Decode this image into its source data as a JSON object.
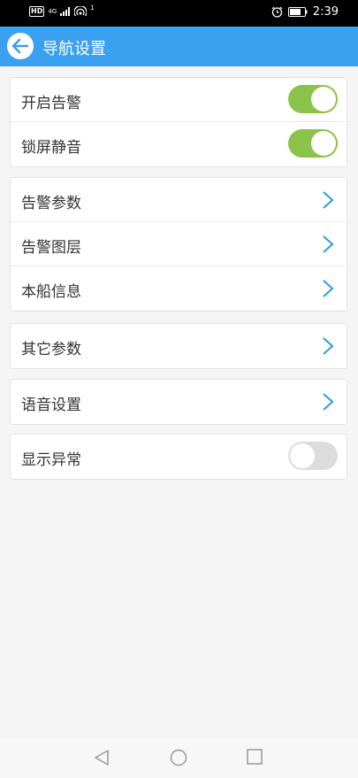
{
  "status_bar": {
    "hd": "HD",
    "network": "4G",
    "hotspot_count": "1",
    "time": "2:39"
  },
  "header": {
    "title": "导航设置"
  },
  "groups": [
    {
      "items": [
        {
          "label": "开启告警",
          "type": "toggle",
          "on": true
        },
        {
          "label": "锁屏静音",
          "type": "toggle",
          "on": true
        }
      ]
    },
    {
      "items": [
        {
          "label": "告警参数",
          "type": "link"
        },
        {
          "label": "告警图层",
          "type": "link"
        },
        {
          "label": "本船信息",
          "type": "link"
        }
      ]
    },
    {
      "items": [
        {
          "label": "其它参数",
          "type": "link"
        }
      ]
    },
    {
      "items": [
        {
          "label": "语音设置",
          "type": "link"
        }
      ]
    },
    {
      "items": [
        {
          "label": "显示异常",
          "type": "toggle",
          "on": false
        }
      ]
    }
  ],
  "colors": {
    "header_bg": "#3aa0f0",
    "toggle_on": "#8bc34a",
    "toggle_off": "#dcdcdc",
    "chevron": "#2a9fd6"
  }
}
